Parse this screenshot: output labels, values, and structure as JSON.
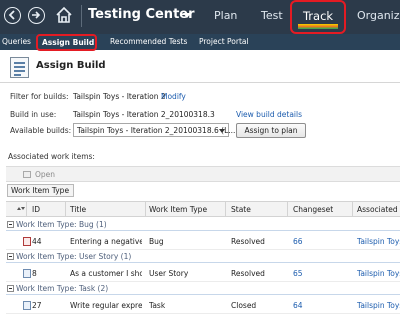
{
  "topnav": {
    "title": "Testing Center",
    "items": [
      "Plan",
      "Test",
      "Track",
      "Organize"
    ],
    "selected": "Track"
  },
  "subnav": {
    "items": [
      "Queries",
      "Assign Build",
      "Recommended Tests",
      "Project Portal"
    ],
    "selected": "Assign Build"
  },
  "page": {
    "title": "Assign Build",
    "filter_label": "Filter for builds:",
    "filter_value": "Tailspin Toys - Iteration 2",
    "modify_link": "Modify",
    "build_in_use_label": "Build in use:",
    "build_in_use_value": "Tailspin Toys - Iteration 2_20100318.3",
    "view_details_link": "View build details",
    "available_label": "Available builds:",
    "available_selected": "Tailspin Toys - Iteration 2_20100318.6 (L...",
    "assign_button": "Assign to plan",
    "associated_label": "Associated work items:"
  },
  "toolbar": {
    "open_label": "Open"
  },
  "groupby_chip": "Work Item Type",
  "grid": {
    "columns": [
      "ID",
      "Title",
      "Work Item Type",
      "State",
      "Changeset",
      "Associated b"
    ],
    "groups": [
      {
        "label": "Work Item Type: Bug (1)",
        "rows": [
          {
            "id": "44",
            "title": "Entering a negative n...",
            "type": "Bug",
            "state": "Resolved",
            "changeset": "66",
            "associated": "Tailspin Toys"
          }
        ]
      },
      {
        "label": "Work Item Type: User Story (1)",
        "rows": [
          {
            "id": "8",
            "title": "As a customer I shou...",
            "type": "User Story",
            "state": "Resolved",
            "changeset": "65",
            "associated": "Tailspin Toys"
          }
        ]
      },
      {
        "label": "Work Item Type: Task (2)",
        "rows": [
          {
            "id": "27",
            "title": "Write regular express...",
            "type": "Task",
            "state": "Closed",
            "changeset": "64",
            "associated": "Tailspin Toys"
          }
        ]
      }
    ]
  },
  "colors": {
    "topbar": "#2c3a4a",
    "subbar": "#2a4258",
    "highlight_red": "#e41b23",
    "link_blue": "#1c5cae"
  },
  "icons": {
    "back": "back-arrow-icon",
    "forward": "forward-arrow-icon",
    "home": "home-icon",
    "assign_build": "assign-build-icon",
    "open": "open-icon",
    "bug": "bug-icon",
    "work_item": "work-item-icon"
  }
}
